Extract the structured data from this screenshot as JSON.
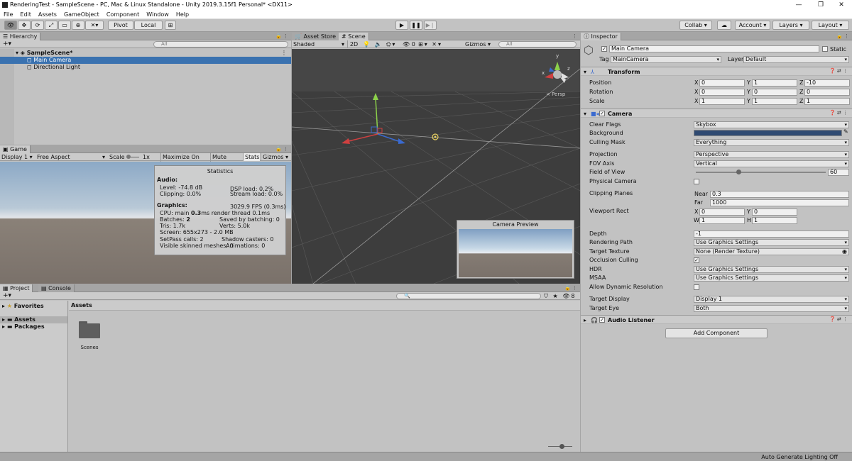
{
  "window": {
    "title": "RenderingTest - SampleScene - PC, Mac & Linux Standalone - Unity 2019.3.15f1 Personal* <DX11>",
    "minimize": "—",
    "maximize": "❐",
    "close": "✕"
  },
  "menu": [
    "File",
    "Edit",
    "Assets",
    "GameObject",
    "Component",
    "Window",
    "Help"
  ],
  "toolbar": {
    "pivot": "Pivot",
    "local": "Local",
    "collab": "Collab ▾",
    "account": "Account",
    "layers": "Layers",
    "layout": "Layout"
  },
  "hierarchy": {
    "tab": "Hierarchy",
    "search": "All",
    "scene": "SampleScene*",
    "items": [
      "Main Camera",
      "Directional Light"
    ]
  },
  "game": {
    "tab": "Game",
    "display": "Display 1",
    "aspect": "Free Aspect",
    "scale_label": "Scale",
    "scale_value": "1x",
    "maximize": "Maximize On Play",
    "mute": "Mute Audio",
    "stats": "Stats",
    "gizmos": "Gizmos"
  },
  "stats": {
    "title": "Statistics",
    "audio": "Audio:",
    "level": "Level: -74.8 dB",
    "dsp": "DSP load: 0.2%",
    "clipping": "Clipping: 0.0%",
    "stream": "Stream load: 0.0%",
    "graphics": "Graphics:",
    "fps": "3029.9 FPS (0.3ms)",
    "cpu_a": "CPU: main ",
    "cpu_b": "0.3",
    "cpu_c": "ms  render thread 0.1ms",
    "batches_a": "Batches: ",
    "batches_b": "2",
    "saved": "Saved by batching: 0",
    "tris": "Tris: 1.7k",
    "verts": "Verts: 5.0k",
    "screen": "Screen: 655x273 - 2.0 MB",
    "setpass": "SetPass calls: 2",
    "shadow": "Shadow casters: 0",
    "skinned": "Visible skinned meshes: 0",
    "animations": "Animations: 0"
  },
  "scene": {
    "tab_store": "Asset Store",
    "tab_scene": "Scene",
    "shaded": "Shaded",
    "mode2d": "2D",
    "fx_count": "0",
    "gizmos": "Gizmos",
    "search": "All",
    "persp": "< Persp",
    "axis_x": "x",
    "axis_y": "y",
    "axis_z": "z",
    "preview_title": "Camera Preview"
  },
  "project": {
    "tab_project": "Project",
    "tab_console": "Console",
    "favorites": "Favorites",
    "assets": "Assets",
    "packages": "Packages",
    "breadcrumb": "Assets",
    "folder": "Scenes",
    "count": "8"
  },
  "inspector": {
    "tab": "Inspector",
    "name": "Main Camera",
    "static": "Static",
    "tag_label": "Tag",
    "tag": "MainCamera",
    "layer_label": "Layer",
    "layer": "Default",
    "transform": {
      "title": "Transform",
      "position": "Position",
      "rotation": "Rotation",
      "scale": "Scale",
      "pos": [
        "0",
        "1",
        "-10"
      ],
      "rot": [
        "0",
        "0",
        "0"
      ],
      "scl": [
        "1",
        "1",
        "1"
      ]
    },
    "camera": {
      "title": "Camera",
      "clear_flags": "Clear Flags",
      "clear_flags_v": "Skybox",
      "background": "Background",
      "culling": "Culling Mask",
      "culling_v": "Everything",
      "projection": "Projection",
      "projection_v": "Perspective",
      "fov_axis": "FOV Axis",
      "fov_axis_v": "Vertical",
      "fov": "Field of View",
      "fov_v": "60",
      "physical": "Physical Camera",
      "clipping": "Clipping Planes",
      "near_l": "Near",
      "near": "0.3",
      "far_l": "Far",
      "far": "1000",
      "viewport": "Viewport Rect",
      "vx": "0",
      "vy": "0",
      "vw": "1",
      "vh": "1",
      "depth": "Depth",
      "depth_v": "-1",
      "rpath": "Rendering Path",
      "rpath_v": "Use Graphics Settings",
      "target_tex": "Target Texture",
      "target_tex_v": "None (Render Texture)",
      "occlusion": "Occlusion Culling",
      "hdr": "HDR",
      "hdr_v": "Use Graphics Settings",
      "msaa": "MSAA",
      "msaa_v": "Use Graphics Settings",
      "dynres": "Allow Dynamic Resolution",
      "tdisplay": "Target Display",
      "tdisplay_v": "Display 1",
      "teye": "Target Eye",
      "teye_v": "Both"
    },
    "audio_listener": "Audio Listener",
    "add_component": "Add Component",
    "axis_x": "X",
    "axis_y": "Y",
    "axis_z": "Z",
    "axis_w": "W",
    "axis_h": "H"
  },
  "status": {
    "lighting": "Auto Generate Lighting Off"
  },
  "colors": {
    "panel": "#c2c2c2",
    "selection": "#3a72b0",
    "scene_bg": "#3d3d3d",
    "camera_bg": "#2f4a72"
  }
}
